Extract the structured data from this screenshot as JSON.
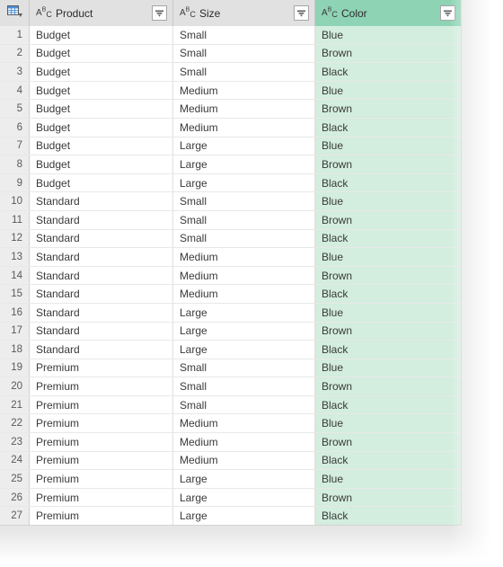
{
  "app": {
    "name": "Power Query Data Preview",
    "accent_color": "#00b294",
    "header_bg": "#e1e1e1",
    "selected_header_bg": "#8ed3b4",
    "selected_cell_bg": "#d3edde",
    "rownum_bg": "#ededed",
    "page_bg": "#e6e6e6"
  },
  "corner": {
    "icon": "table-grid-icon",
    "tooltip": "Table options"
  },
  "columns": [
    {
      "key": "product",
      "label": "Product",
      "type_icon": "abc-text-type-icon",
      "type_icon_text": "ABC",
      "filter_icon": "filter-dropdown-icon",
      "selected": false
    },
    {
      "key": "size",
      "label": "Size",
      "type_icon": "abc-text-type-icon",
      "type_icon_text": "ABC",
      "filter_icon": "filter-dropdown-icon",
      "selected": false
    },
    {
      "key": "color",
      "label": "Color",
      "type_icon": "abc-text-type-icon",
      "type_icon_text": "ABC",
      "filter_icon": "filter-dropdown-icon",
      "selected": true
    }
  ],
  "rows": [
    {
      "n": "1",
      "product": "Budget",
      "size": "Small",
      "color": "Blue"
    },
    {
      "n": "2",
      "product": "Budget",
      "size": "Small",
      "color": "Brown"
    },
    {
      "n": "3",
      "product": "Budget",
      "size": "Small",
      "color": "Black"
    },
    {
      "n": "4",
      "product": "Budget",
      "size": "Medium",
      "color": "Blue"
    },
    {
      "n": "5",
      "product": "Budget",
      "size": "Medium",
      "color": "Brown"
    },
    {
      "n": "6",
      "product": "Budget",
      "size": "Medium",
      "color": "Black"
    },
    {
      "n": "7",
      "product": "Budget",
      "size": "Large",
      "color": "Blue"
    },
    {
      "n": "8",
      "product": "Budget",
      "size": "Large",
      "color": "Brown"
    },
    {
      "n": "9",
      "product": "Budget",
      "size": "Large",
      "color": "Black"
    },
    {
      "n": "10",
      "product": "Standard",
      "size": "Small",
      "color": "Blue"
    },
    {
      "n": "11",
      "product": "Standard",
      "size": "Small",
      "color": "Brown"
    },
    {
      "n": "12",
      "product": "Standard",
      "size": "Small",
      "color": "Black"
    },
    {
      "n": "13",
      "product": "Standard",
      "size": "Medium",
      "color": "Blue"
    },
    {
      "n": "14",
      "product": "Standard",
      "size": "Medium",
      "color": "Brown"
    },
    {
      "n": "15",
      "product": "Standard",
      "size": "Medium",
      "color": "Black"
    },
    {
      "n": "16",
      "product": "Standard",
      "size": "Large",
      "color": "Blue"
    },
    {
      "n": "17",
      "product": "Standard",
      "size": "Large",
      "color": "Brown"
    },
    {
      "n": "18",
      "product": "Standard",
      "size": "Large",
      "color": "Black"
    },
    {
      "n": "19",
      "product": "Premium",
      "size": "Small",
      "color": "Blue"
    },
    {
      "n": "20",
      "product": "Premium",
      "size": "Small",
      "color": "Brown"
    },
    {
      "n": "21",
      "product": "Premium",
      "size": "Small",
      "color": "Black"
    },
    {
      "n": "22",
      "product": "Premium",
      "size": "Medium",
      "color": "Blue"
    },
    {
      "n": "23",
      "product": "Premium",
      "size": "Medium",
      "color": "Brown"
    },
    {
      "n": "24",
      "product": "Premium",
      "size": "Medium",
      "color": "Black"
    },
    {
      "n": "25",
      "product": "Premium",
      "size": "Large",
      "color": "Blue"
    },
    {
      "n": "26",
      "product": "Premium",
      "size": "Large",
      "color": "Brown"
    },
    {
      "n": "27",
      "product": "Premium",
      "size": "Large",
      "color": "Black"
    }
  ]
}
